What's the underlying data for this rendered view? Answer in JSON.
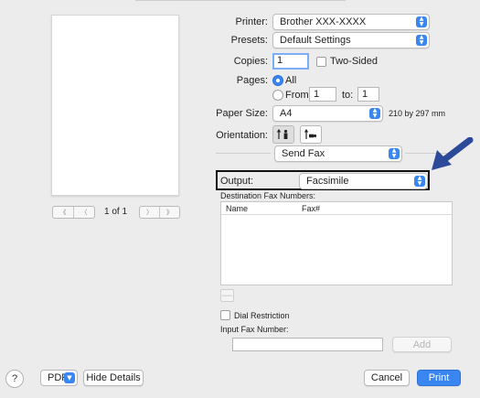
{
  "preview": {
    "page_indicator": "1 of 1",
    "first_glyph": "《",
    "prev_glyph": "〈",
    "next_glyph": "〉",
    "last_glyph": "》"
  },
  "printer": {
    "label": "Printer:",
    "value": "Brother XXX-XXXX"
  },
  "presets": {
    "label": "Presets:",
    "value": "Default Settings"
  },
  "copies": {
    "label": "Copies:",
    "value": "1",
    "two_sided_label": "Two-Sided"
  },
  "pages": {
    "label": "Pages:",
    "all_label": "All",
    "from_label": "From:",
    "from_value": "1",
    "to_label": "to:",
    "to_value": "1"
  },
  "paper_size": {
    "label": "Paper Size:",
    "value": "A4",
    "dimensions": "210 by 297 mm"
  },
  "orientation": {
    "label": "Orientation:"
  },
  "section_menu": {
    "value": "Send Fax"
  },
  "output": {
    "label": "Output:",
    "value": "Facsimile"
  },
  "destination": {
    "label": "Destination Fax Numbers:",
    "columns": [
      "Name",
      "Fax#"
    ],
    "remove_label": "—"
  },
  "dial_restriction": {
    "label": "Dial Restriction"
  },
  "input_fax": {
    "label": "Input Fax Number:",
    "value": "",
    "add_label": "Add"
  },
  "footer": {
    "help_label": "?",
    "pdf_label": "PDF",
    "hide_details_label": "Hide Details",
    "cancel_label": "Cancel",
    "print_label": "Print"
  },
  "colors": {
    "accent": "#3a86f0",
    "arrow": "#2c4a9a"
  },
  "icons": [
    "chevron-updown-icon",
    "portrait-orientation-icon",
    "landscape-orientation-icon",
    "arrow-callout-icon"
  ]
}
